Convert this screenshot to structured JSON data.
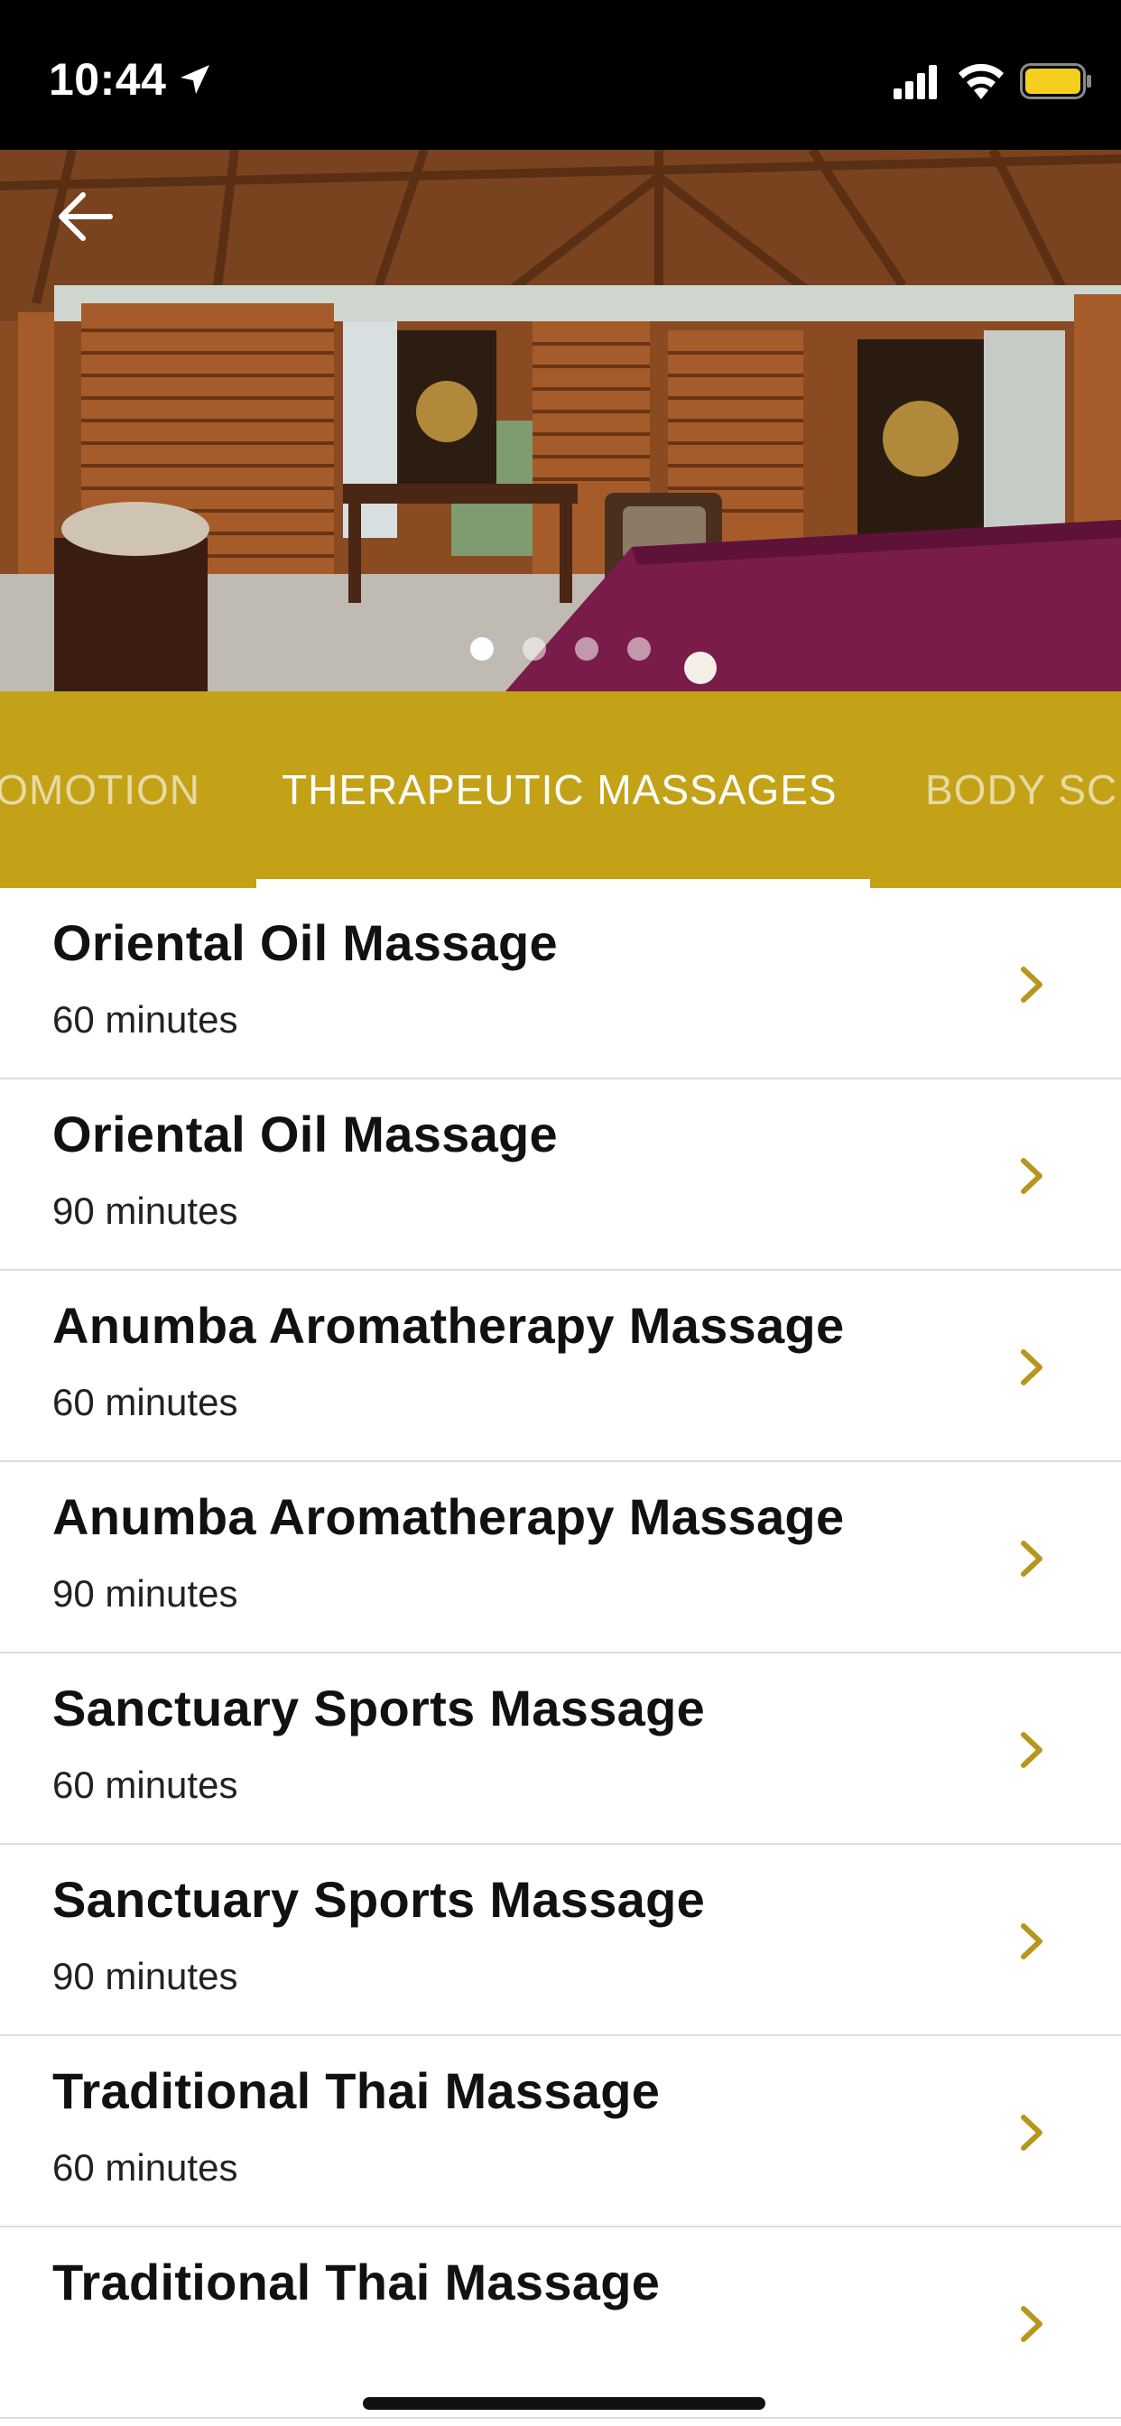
{
  "status_bar": {
    "time": "10:44",
    "battery_color": "#f5cf1d",
    "icons": [
      "location-arrow-icon",
      "cellular-signal-icon",
      "wifi-icon",
      "battery-icon"
    ]
  },
  "hero": {
    "back_icon": "back-arrow-icon",
    "pages": 4,
    "active_page": 1
  },
  "tabs": {
    "items": [
      {
        "label": "OMOTION"
      },
      {
        "label": "THERAPEUTIC MASSAGES"
      },
      {
        "label": "BODY SC"
      }
    ],
    "selected": "THERAPEUTIC MASSAGES",
    "background_color": "#c4a217"
  },
  "services": [
    {
      "name": "Oriental Oil Massage",
      "duration": "60 minutes"
    },
    {
      "name": "Oriental Oil Massage",
      "duration": "90 minutes"
    },
    {
      "name": "Anumba Aromatherapy Massage",
      "duration": "60 minutes"
    },
    {
      "name": "Anumba Aromatherapy Massage",
      "duration": "90 minutes"
    },
    {
      "name": "Sanctuary Sports Massage",
      "duration": "60 minutes"
    },
    {
      "name": "Sanctuary Sports Massage",
      "duration": "90 minutes"
    },
    {
      "name": "Traditional Thai Massage",
      "duration": "60 minutes"
    },
    {
      "name": "Traditional Thai Massage",
      "duration": ""
    }
  ],
  "accent_color": "#b8961a"
}
